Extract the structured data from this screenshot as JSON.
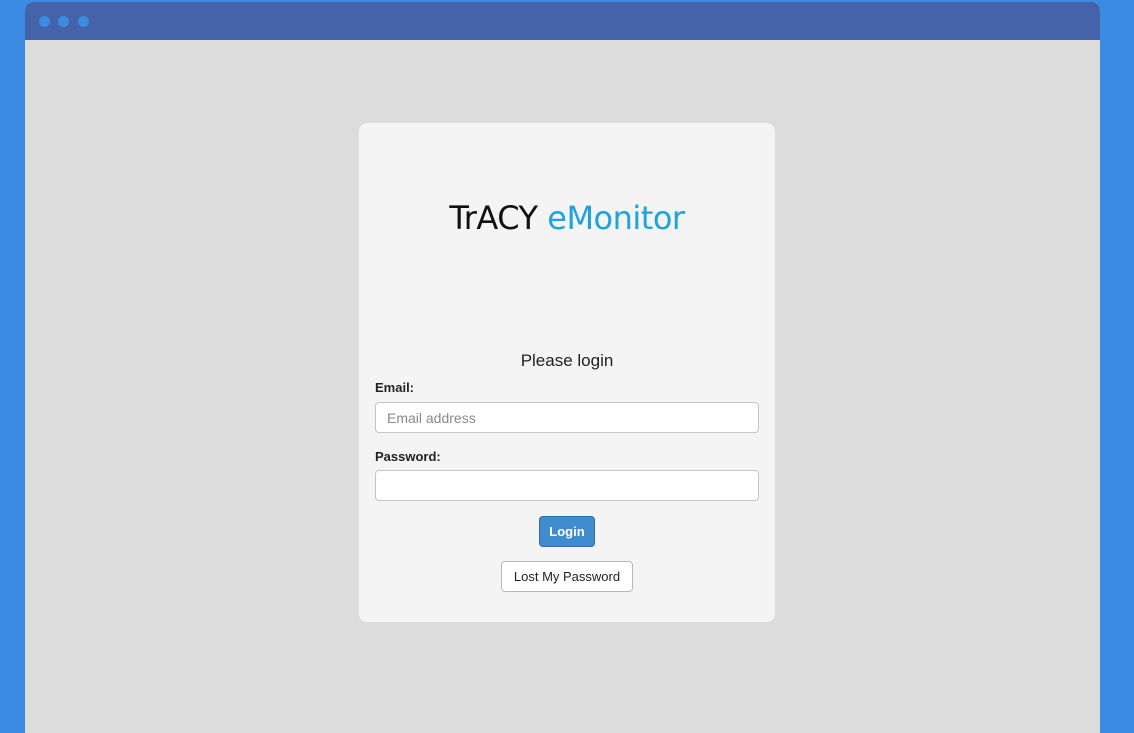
{
  "window": {
    "controls": [
      "window-dot",
      "window-dot",
      "window-dot"
    ]
  },
  "logo": {
    "part1": "TrACY",
    "part2": "eMonitor"
  },
  "login": {
    "heading": "Please login",
    "email_label": "Email:",
    "email_placeholder": "Email address",
    "email_value": "",
    "password_label": "Password:",
    "password_value": "",
    "login_button": "Login",
    "lost_password_button": "Lost My Password"
  },
  "colors": {
    "page_background": "#3b8be3",
    "titlebar": "#4563a8",
    "window_background": "#dcdcdc",
    "card_background": "#f4f4f4",
    "logo_accent": "#1ea3dc",
    "primary_button": "#3f8ccf"
  }
}
